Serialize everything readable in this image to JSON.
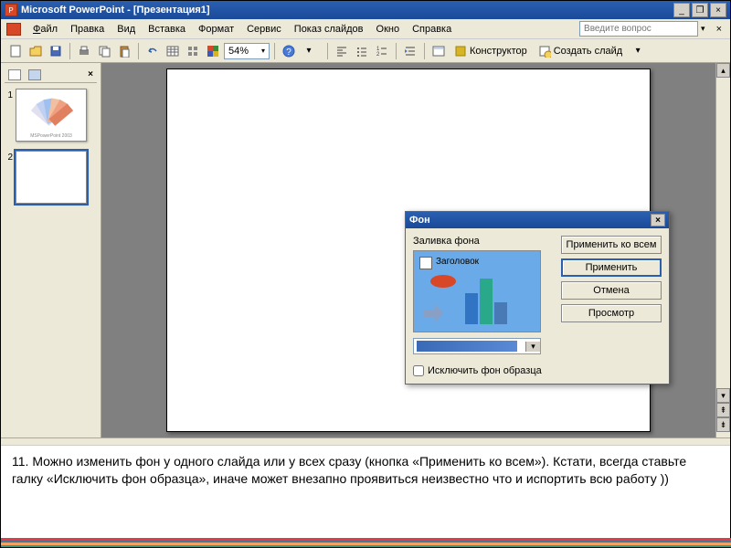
{
  "window": {
    "title": "Microsoft PowerPoint - [Презентация1]",
    "app_icon_letter": "P"
  },
  "menu": {
    "file": "Файл",
    "edit": "Правка",
    "view": "Вид",
    "insert": "Вставка",
    "format": "Формат",
    "service": "Сервис",
    "slideshow": "Показ слайдов",
    "window": "Окно",
    "help": "Справка",
    "ask_placeholder": "Введите вопрос"
  },
  "toolbar": {
    "zoom": "54%",
    "designer_label": "Конструктор",
    "new_slide_label": "Создать слайд"
  },
  "slides": {
    "s1_num": "1",
    "s2_num": "2",
    "thumb1_caption": "MSPowerPoint 2003"
  },
  "dialog": {
    "title": "Фон",
    "fill_label": "Заливка фона",
    "preview_title": "Заголовок",
    "apply_all": "Применить ко всем",
    "apply": "Применить",
    "cancel": "Отмена",
    "preview_btn": "Просмотр",
    "exclude_master": "Исключить фон образца"
  },
  "instruction": {
    "text": "11.   Можно изменить фон у одного слайда или у всех сразу (кнопка «Применить ко всем»). Кстати, всегда ставьте галку «Исключить фон образца», иначе может внезапно проявиться неизвестно что и испортить всю работу ))"
  },
  "colors": {
    "stripe1": "#e63946",
    "stripe2": "#457b9d",
    "stripe3": "#f4a261",
    "stripe4": "#2a9d8f"
  }
}
